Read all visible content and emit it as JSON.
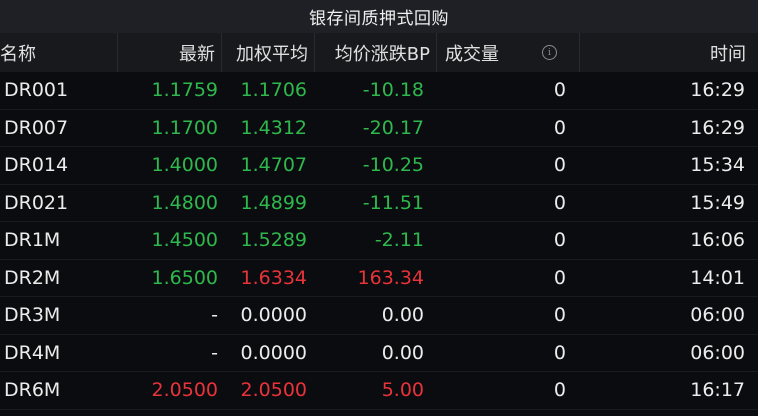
{
  "title": "银存间质押式回购",
  "columns": {
    "name": "名称",
    "last": "最新",
    "wavg": "加权平均",
    "bp": "均价涨跌BP",
    "volume": "成交量",
    "info_icon": "ⓘ",
    "time": "时间"
  },
  "rows": [
    {
      "name": "DR001",
      "last": "1.1759",
      "wavg": "1.1706",
      "bp": "-10.18",
      "volume": "0",
      "time": "16:29",
      "last_color": "green",
      "wavg_color": "green",
      "bp_color": "green"
    },
    {
      "name": "DR007",
      "last": "1.1700",
      "wavg": "1.4312",
      "bp": "-20.17",
      "volume": "0",
      "time": "16:29",
      "last_color": "green",
      "wavg_color": "green",
      "bp_color": "green"
    },
    {
      "name": "DR014",
      "last": "1.4000",
      "wavg": "1.4707",
      "bp": "-10.25",
      "volume": "0",
      "time": "15:34",
      "last_color": "green",
      "wavg_color": "green",
      "bp_color": "green"
    },
    {
      "name": "DR021",
      "last": "1.4800",
      "wavg": "1.4899",
      "bp": "-11.51",
      "volume": "0",
      "time": "15:49",
      "last_color": "green",
      "wavg_color": "green",
      "bp_color": "green"
    },
    {
      "name": "DR1M",
      "last": "1.4500",
      "wavg": "1.5289",
      "bp": "-2.11",
      "volume": "0",
      "time": "16:06",
      "last_color": "green",
      "wavg_color": "green",
      "bp_color": "green"
    },
    {
      "name": "DR2M",
      "last": "1.6500",
      "wavg": "1.6334",
      "bp": "163.34",
      "volume": "0",
      "time": "14:01",
      "last_color": "green",
      "wavg_color": "red",
      "bp_color": "red"
    },
    {
      "name": "DR3M",
      "last": "-",
      "wavg": "0.0000",
      "bp": "0.00",
      "volume": "0",
      "time": "06:00",
      "last_color": "white",
      "wavg_color": "white",
      "bp_color": "white"
    },
    {
      "name": "DR4M",
      "last": "-",
      "wavg": "0.0000",
      "bp": "0.00",
      "volume": "0",
      "time": "06:00",
      "last_color": "white",
      "wavg_color": "white",
      "bp_color": "white"
    },
    {
      "name": "DR6M",
      "last": "2.0500",
      "wavg": "2.0500",
      "bp": "5.00",
      "volume": "0",
      "time": "16:17",
      "last_color": "red",
      "wavg_color": "red",
      "bp_color": "red"
    }
  ],
  "colors": {
    "green": "#2fb84d",
    "red": "#e8333a",
    "white": "#ececec",
    "background": "#0b0c0f",
    "header_bg": "#18191d",
    "title_bg": "#1f2025"
  }
}
